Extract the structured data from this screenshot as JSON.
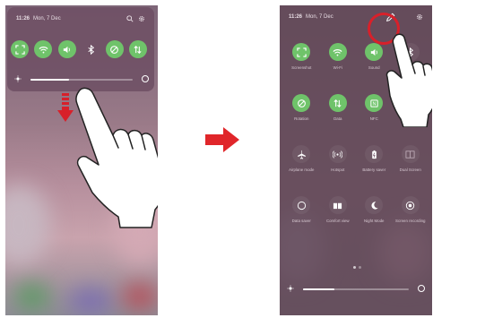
{
  "left_phone": {
    "status": {
      "time": "11:26",
      "date": "Mon, 7 Dec"
    },
    "quick_tiles": [
      {
        "name": "screen-capture-icon",
        "active": true
      },
      {
        "name": "wifi-icon",
        "active": true
      },
      {
        "name": "sound-icon",
        "active": true
      },
      {
        "name": "bluetooth-icon",
        "active": false
      },
      {
        "name": "rotation-icon",
        "active": true
      },
      {
        "name": "data-icon",
        "active": true
      }
    ],
    "brightness": {
      "level": 0.38,
      "min_label": "dim",
      "auto_label": "auto"
    }
  },
  "right_phone": {
    "status": {
      "time": "11:26",
      "date": "Mon, 7 Dec"
    },
    "tiles": [
      {
        "label": "Screenshot",
        "icon": "screenshot-icon",
        "active": true
      },
      {
        "label": "Wi-Fi",
        "icon": "wifi-icon",
        "active": true
      },
      {
        "label": "Sound",
        "icon": "sound-icon",
        "active": true
      },
      {
        "label": "Bluetooth",
        "icon": "bluetooth-icon",
        "active": false
      },
      {
        "label": "Rotation",
        "icon": "rotation-icon",
        "active": true
      },
      {
        "label": "Data",
        "icon": "data-icon",
        "active": true
      },
      {
        "label": "NFC",
        "icon": "nfc-icon",
        "active": true
      },
      {
        "label": "Flashlight",
        "icon": "flashlight-icon",
        "active": false
      },
      {
        "label": "Airplane mode",
        "icon": "airplane-icon",
        "active": false
      },
      {
        "label": "Hotspot",
        "icon": "hotspot-icon",
        "active": false
      },
      {
        "label": "Battery saver",
        "icon": "battery-icon",
        "active": false
      },
      {
        "label": "Dual Screen",
        "icon": "dual-screen-icon",
        "active": false
      },
      {
        "label": "Data saver",
        "icon": "data-saver-icon",
        "active": false
      },
      {
        "label": "Comfort view",
        "icon": "comfort-view-icon",
        "active": false
      },
      {
        "label": "Night Mode",
        "icon": "night-mode-icon",
        "active": false
      },
      {
        "label": "Screen recording",
        "icon": "screen-recording-icon",
        "active": false
      }
    ],
    "brightness": {
      "level": 0.3,
      "min_label": "dim",
      "auto_label": "auto"
    }
  },
  "colors": {
    "tile_on": "#6fc36a",
    "arrow_red": "#d8202a",
    "panel": "#6e5064"
  }
}
